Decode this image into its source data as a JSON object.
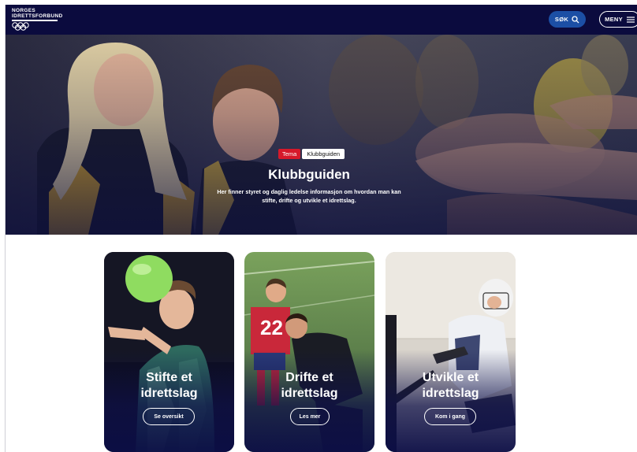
{
  "header": {
    "logo_line1": "NORGES",
    "logo_line2": "IDRETTSFORBUND",
    "search_label": "SØK",
    "menu_label": "MENY"
  },
  "hero": {
    "tag_primary": "Tema",
    "tag_secondary": "Klubbguiden",
    "title": "Klubbguiden",
    "description": "Her finner styret og daglig ledelse informasjon om hvordan man kan stifte, drifte og utvikle et idrettslag."
  },
  "cards": [
    {
      "title_line1": "Stifte et",
      "title_line2": "idrettslag",
      "button": "Se oversikt"
    },
    {
      "title_line1": "Drifte et",
      "title_line2": "idrettslag",
      "button": "Les mer"
    },
    {
      "title_line1": "Utvikle et",
      "title_line2": "idrettslag",
      "button": "Kom i gang"
    }
  ],
  "colors": {
    "header_bg": "#0b0b3e",
    "search_bg": "#1c4fa5",
    "tag_red": "#d6192a"
  }
}
